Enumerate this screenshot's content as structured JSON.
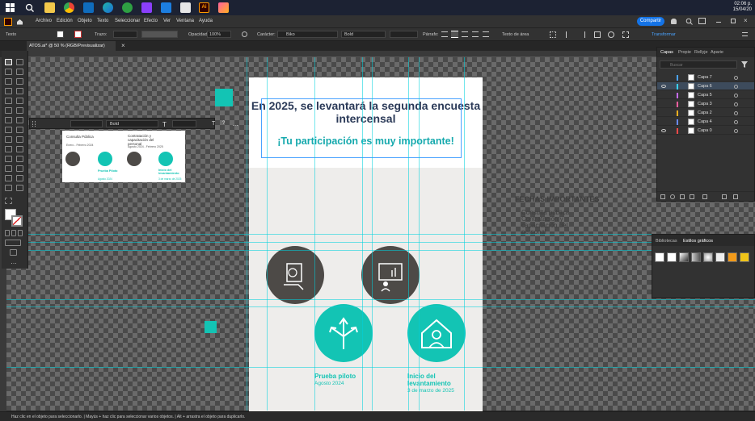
{
  "taskbar": {
    "apps": [
      "start",
      "search",
      "file-explorer",
      "chrome",
      "outlook",
      "edge",
      "browser",
      "gallery",
      "store",
      "security",
      "illustrator",
      "paint"
    ],
    "clock_time": "02:06 p.",
    "clock_date": "15/04/20"
  },
  "menubar": {
    "items": [
      "Archivo",
      "Edición",
      "Objeto",
      "Texto",
      "Seleccionar",
      "Efecto",
      "Ver",
      "Ventana",
      "Ayuda"
    ],
    "share_label": "Compartir"
  },
  "control_bar": {
    "mode_label": "Texto",
    "stroke_label": "Trazo:",
    "opacity_label": "Opacidad:",
    "opacity_value": "100%",
    "character_label": "Carácter:",
    "font_value": "Biko",
    "weight_value": "Bold",
    "paragraph_label": "Párrafo:",
    "area_text_label": "Texto de área",
    "transform_label": "Transformar"
  },
  "document": {
    "tab_title": "ATOS.ai* @ 50 % (RGB/Previsualizar)"
  },
  "artboard": {
    "title": "En 2025, se levantará la segunda encuesta intercensal",
    "subtitle": "¡Tu participación es muy importante!",
    "steps": [
      {
        "title": "Prueba piloto",
        "date": "Agosto 2024"
      },
      {
        "title": "Inicio del levantamiento",
        "date": "3 de marzo de 2025"
      }
    ]
  },
  "thumbnail": {
    "col1_title": "Consulta Pública",
    "col1_date": "Enero - Febrero 2024",
    "col2_title": "Contratación y capacitación del personal",
    "col2_date": "Agosto 2024 - Febrero 2025",
    "step3_title": "Prueba Piloto",
    "step3_date": "Agosto 2024",
    "step4_title": "Inicio del levantamiento",
    "step4_date": "3 de marzo de 2025"
  },
  "float_bar": {
    "weight_value": "Bold"
  },
  "ghost_text": {
    "heading": "FECHAS IMPORTANTES",
    "lines": [
      "Consulta pública",
      "Contratación y",
      "capacitación del",
      "personal"
    ]
  },
  "layers_panel": {
    "tabs": [
      "Capas",
      "Propie",
      "Rellyje",
      "Aparie"
    ],
    "search_placeholder": "Buscar",
    "layers": [
      {
        "name": "Capa 7",
        "color": "#4aa3ff",
        "visible": false
      },
      {
        "name": "Capa 6",
        "color": "#3ad1ff",
        "visible": true,
        "selected": true
      },
      {
        "name": "Capa 5",
        "color": "#c66cff",
        "visible": false
      },
      {
        "name": "Capa 3",
        "color": "#ff5fa0",
        "visible": false
      },
      {
        "name": "Capa 2",
        "color": "#ffb020",
        "visible": false
      },
      {
        "name": "Capa 4",
        "color": "#6a8bff",
        "visible": false
      },
      {
        "name": "Capa 0",
        "color": "#ff4848",
        "visible": true
      }
    ]
  },
  "graphic_styles_panel": {
    "tabs": [
      "Bibliotecas",
      "Estilos gráficos"
    ]
  },
  "statusbar": {
    "text": "Haz clic en el objeto para seleccionarlo. | Mayús + haz clic para seleccionar varios objetos. | Alt + arrastra el objeto para duplicarlo."
  },
  "colors": {
    "accent": "#13c4b4",
    "navy": "#2b3a58",
    "dark_circle": "#4d4a47",
    "ui_blue": "#1473e6"
  }
}
